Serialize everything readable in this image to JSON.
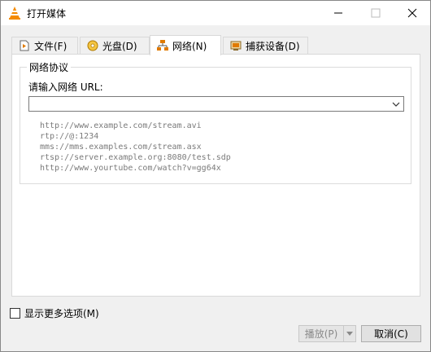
{
  "window": {
    "title": "打开媒体",
    "icon": "vlc-cone-icon"
  },
  "tabs": [
    {
      "label": "文件(F)",
      "icon": "file-play-icon",
      "active": false
    },
    {
      "label": "光盘(D)",
      "icon": "disc-icon",
      "active": false
    },
    {
      "label": "网络(N)",
      "icon": "network-icon",
      "active": true
    },
    {
      "label": "捕获设备(D)",
      "icon": "capture-device-icon",
      "active": false
    }
  ],
  "network": {
    "group_title": "网络协议",
    "url_label": "请输入网络 URL:",
    "url_value": "",
    "examples": [
      "http://www.example.com/stream.avi",
      "rtp://@:1234",
      "mms://mms.examples.com/stream.asx",
      "rtsp://server.example.org:8080/test.sdp",
      "http://www.yourtube.com/watch?v=gg64x"
    ]
  },
  "footer": {
    "more_options_label": "显示更多选项(M)",
    "more_options_checked": false,
    "play_label": "播放(P)",
    "play_enabled": false,
    "cancel_label": "取消(C)"
  },
  "colors": {
    "vlc_orange": "#f48b00",
    "example_text": "#7a7a7a"
  }
}
